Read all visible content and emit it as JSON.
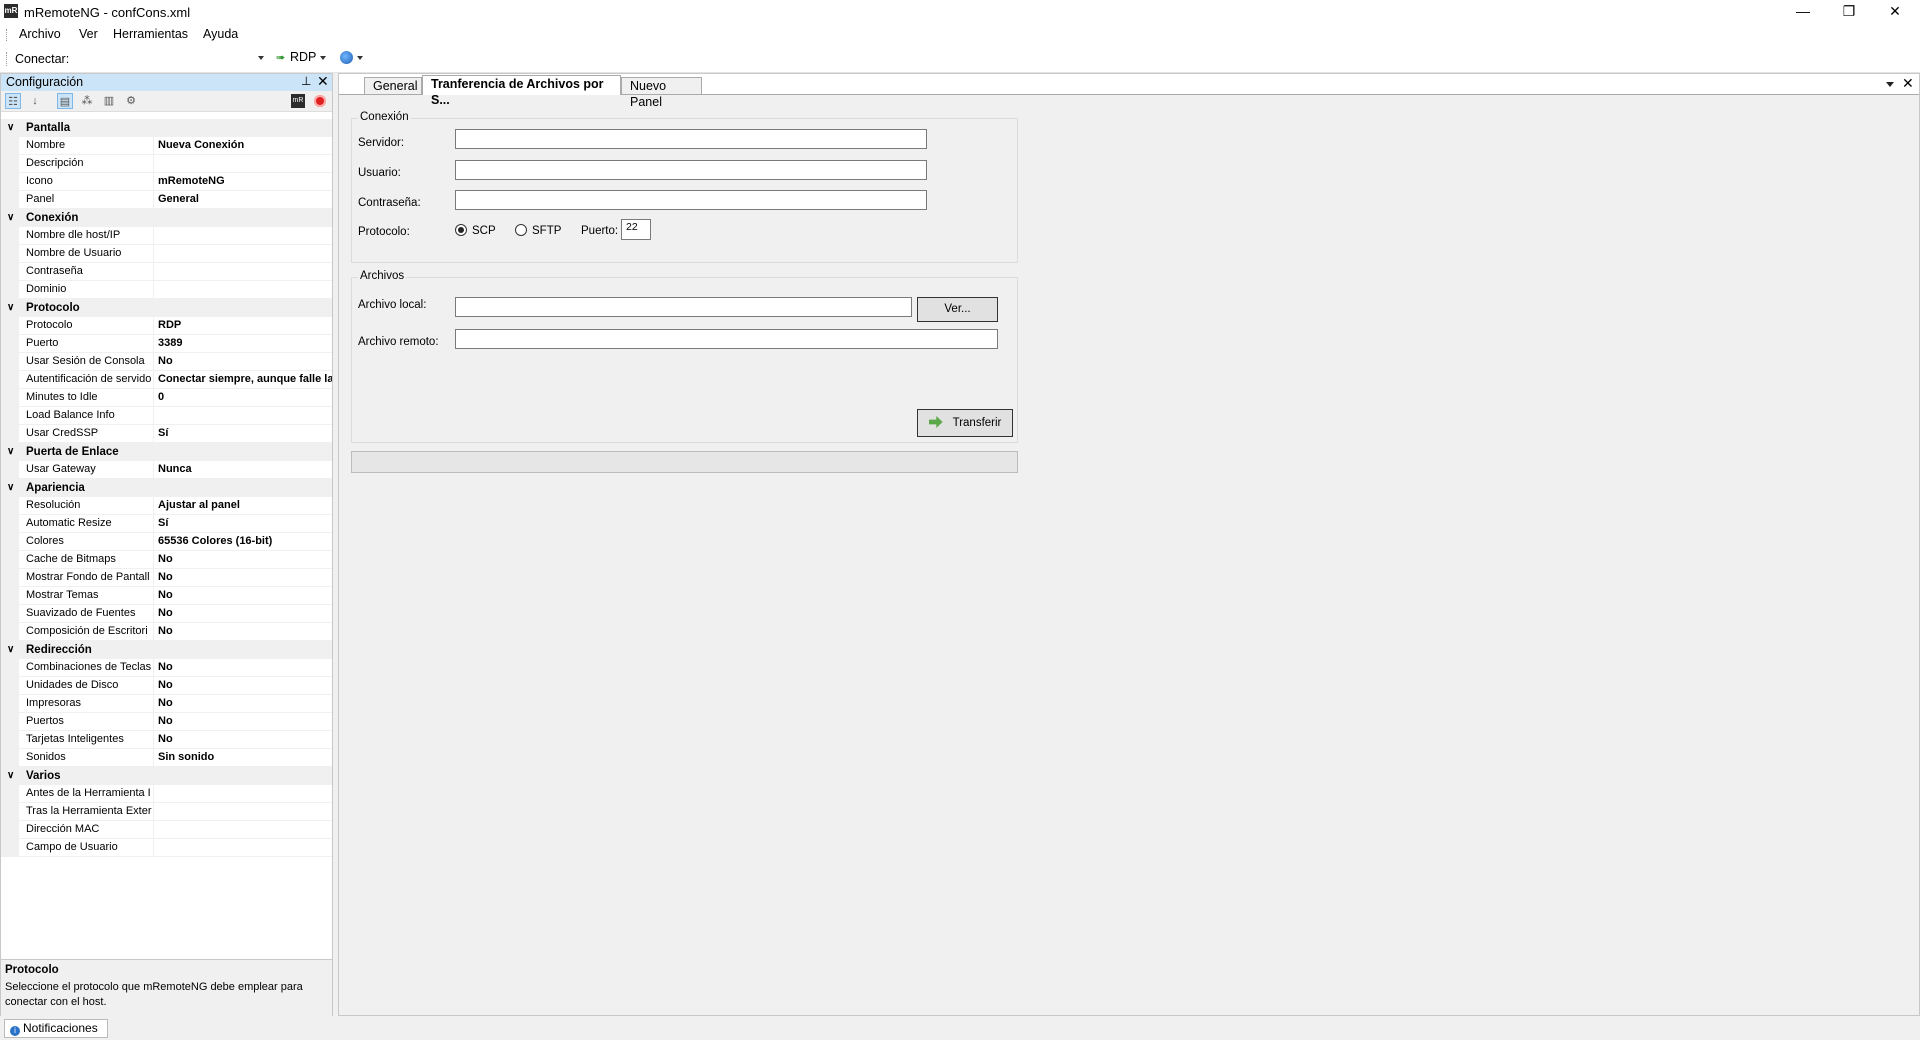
{
  "window": {
    "title": "mRemoteNG - confCons.xml",
    "app_icon": "mR",
    "controls": {
      "minimize": "—",
      "restore": "❐",
      "close": "✕"
    }
  },
  "menu": [
    "Archivo",
    "Ver",
    "Herramientas",
    "Ayuda"
  ],
  "toolbar": {
    "connect_label": "Conectar:",
    "connect_value": "",
    "protocol_button": "RDP"
  },
  "config_panel": {
    "title": "Configuración",
    "categories": [
      {
        "name": "Pantalla",
        "rows": [
          {
            "k": "Nombre",
            "v": "Nueva Conexión"
          },
          {
            "k": "Descripción",
            "v": ""
          },
          {
            "k": "Icono",
            "v": "mRemoteNG"
          },
          {
            "k": "Panel",
            "v": "General"
          }
        ]
      },
      {
        "name": "Conexión",
        "rows": [
          {
            "k": "Nombre dle host/IP",
            "v": ""
          },
          {
            "k": "Nombre de Usuario",
            "v": ""
          },
          {
            "k": "Contraseña",
            "v": ""
          },
          {
            "k": "Dominio",
            "v": ""
          }
        ]
      },
      {
        "name": "Protocolo",
        "rows": [
          {
            "k": "Protocolo",
            "v": "RDP"
          },
          {
            "k": "Puerto",
            "v": "3389"
          },
          {
            "k": "Usar Sesión de Consola",
            "v": "No"
          },
          {
            "k": "Autentificación de servido",
            "v": "Conectar siempre, aunque falle la"
          },
          {
            "k": "Minutes to Idle",
            "v": "0"
          },
          {
            "k": "Load Balance Info",
            "v": ""
          },
          {
            "k": "Usar CredSSP",
            "v": "Sí"
          }
        ]
      },
      {
        "name": "Puerta de Enlace",
        "rows": [
          {
            "k": "Usar Gateway",
            "v": "Nunca"
          }
        ]
      },
      {
        "name": "Apariencia",
        "rows": [
          {
            "k": "Resolución",
            "v": "Ajustar al panel"
          },
          {
            "k": "Automatic Resize",
            "v": "Sí"
          },
          {
            "k": "Colores",
            "v": "65536 Colores (16-bit)"
          },
          {
            "k": "Cache de Bitmaps",
            "v": "No"
          },
          {
            "k": "Mostrar Fondo de Pantall",
            "v": "No"
          },
          {
            "k": "Mostrar Temas",
            "v": "No"
          },
          {
            "k": "Suavizado de Fuentes",
            "v": "No"
          },
          {
            "k": "Composición de Escritori",
            "v": "No"
          }
        ]
      },
      {
        "name": "Redirección",
        "rows": [
          {
            "k": "Combinaciones de Teclas",
            "v": "No"
          },
          {
            "k": "Unidades de Disco",
            "v": "No"
          },
          {
            "k": "Impresoras",
            "v": "No"
          },
          {
            "k": "Puertos",
            "v": "No"
          },
          {
            "k": "Tarjetas Inteligentes",
            "v": "No"
          },
          {
            "k": "Sonidos",
            "v": "Sin sonido"
          }
        ]
      },
      {
        "name": "Varios",
        "rows": [
          {
            "k": "Antes de la Herramienta I",
            "v": ""
          },
          {
            "k": "Tras la Herramienta Exter",
            "v": ""
          },
          {
            "k": "Dirección MAC",
            "v": ""
          },
          {
            "k": "Campo de Usuario",
            "v": ""
          }
        ]
      }
    ],
    "help": {
      "title": "Protocolo",
      "text": "Seleccione el protocolo que mRemoteNG debe emplear para conectar con el host."
    }
  },
  "notifications_tab": "Notificaciones",
  "tabs": [
    {
      "label": "General",
      "active": false
    },
    {
      "label": "Tranferencia de Archivos por S...",
      "active": true
    },
    {
      "label": "Nuevo Panel",
      "active": false
    }
  ],
  "transfer": {
    "connection_group": "Conexión",
    "server_label": "Servidor:",
    "server_value": "",
    "user_label": "Usuario:",
    "user_value": "",
    "password_label": "Contraseña:",
    "password_value": "",
    "protocol_label": "Protocolo:",
    "protocols": [
      {
        "label": "SCP",
        "selected": true
      },
      {
        "label": "SFTP",
        "selected": false
      }
    ],
    "port_label": "Puerto:",
    "port_value": "22",
    "files_group": "Archivos",
    "local_label": "Archivo local:",
    "local_value": "",
    "browse_button": "Ver...",
    "remote_label": "Archivo remoto:",
    "remote_value": "",
    "transfer_button": "Transferir",
    "progress": 0
  }
}
